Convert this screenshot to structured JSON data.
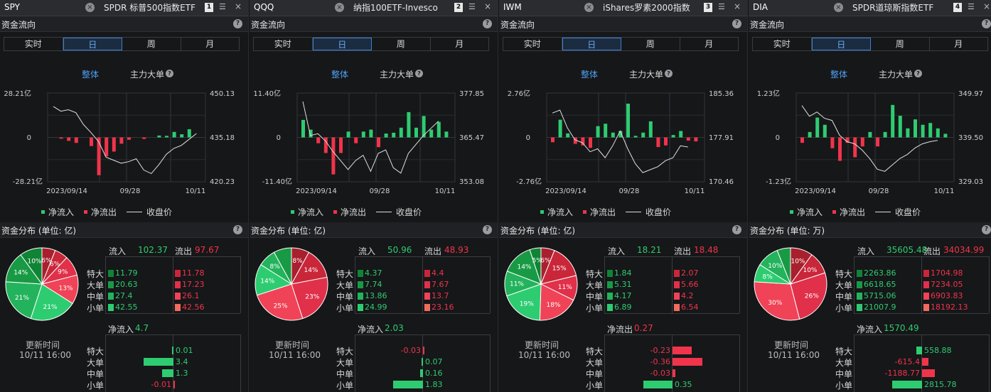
{
  "labels": {
    "flow_section": "资金流向",
    "periods": [
      "实时",
      "日",
      "周",
      "月"
    ],
    "active_period": 1,
    "view_all": "整体",
    "view_main": "主力大单",
    "help": "?",
    "legend_in": "净流入",
    "legend_out": "净流出",
    "legend_close": "收盘价",
    "inflow": "流入",
    "outflow": "流出",
    "rows": [
      "特大",
      "大单",
      "中单",
      "小单"
    ],
    "update_label": "更新时间",
    "update_time": "10/11 16:00",
    "x_ticks": [
      "2023/09/14",
      "09/28",
      "10/11"
    ],
    "close_icon": "×",
    "settings_icon": "settings-sliders-icon"
  },
  "colors": {
    "up": "#2ecc71",
    "down": "#f0344b",
    "bg": "#161719",
    "accent": "#4d9ef0"
  },
  "panels": [
    {
      "code": "SPY",
      "name": "SPDR 标普500指数ETF",
      "num": "1",
      "dist_title": "资金分布 (单位: 亿)",
      "chart_data": {
        "type": "bar",
        "y_left": {
          "top": "28.21亿",
          "mid": "0",
          "bottom": "-28.21亿",
          "max": 28.21
        },
        "y_right": {
          "top": "450.13",
          "mid": "435.18",
          "bottom": "420.23",
          "min": 420.23,
          "max": 450.13
        },
        "flows": [
          0,
          -0.8,
          -2.2,
          -3.5,
          0,
          -5.5,
          -24,
          -12,
          -9,
          -4,
          -1.5,
          0,
          -1,
          0,
          1.2,
          1.0,
          3.5,
          2.0,
          5.2
        ],
        "close": [
          445.6,
          444.0,
          444.5,
          443.5,
          439.5,
          436.8,
          433.8,
          428.5,
          427.5,
          426.5,
          427.0,
          428.0,
          424.2,
          423.0,
          426.0,
          429.5,
          431.5,
          432.5,
          434.5,
          436.5
        ]
      },
      "pie": {
        "type": "pie",
        "values": [
          6,
          6,
          9,
          13,
          21,
          21,
          14,
          10
        ],
        "labels": [
          "6%",
          "6%",
          "9%",
          "13%",
          "21%",
          "21%",
          "14%",
          "10%"
        ]
      },
      "dist": {
        "in_total": "102.37",
        "out_total": "97.67",
        "in": [
          "11.79",
          "20.63",
          "27.4",
          "42.55"
        ],
        "out": [
          "11.78",
          "17.23",
          "26.1",
          "42.56"
        ],
        "net_label": "净流入",
        "net_total": "4.7",
        "net_sign": "up",
        "net": [
          "0.01",
          "3.4",
          "1.3",
          "-0.01"
        ],
        "net_values": [
          0.01,
          3.4,
          1.3,
          -0.01
        ]
      }
    },
    {
      "code": "QQQ",
      "name": "纳指100ETF-Invesco",
      "num": "2",
      "dist_title": "资金分布 (单位: 亿)",
      "chart_data": {
        "type": "bar",
        "y_left": {
          "top": "11.40亿",
          "mid": "0",
          "bottom": "-11.40亿",
          "max": 11.4
        },
        "y_right": {
          "top": "377.85",
          "mid": "365.47",
          "bottom": "353.08",
          "min": 353.08,
          "max": 377.85
        },
        "flows": [
          4.5,
          2.0,
          -1.5,
          -4.0,
          -9.5,
          -4.0,
          1.5,
          -1.5,
          1.5,
          2.0,
          -2.5,
          1.0,
          1.2,
          2.5,
          6.5,
          2.5,
          5.5,
          2.0,
          4.0,
          1.5
        ],
        "close": [
          375.5,
          366.0,
          366.5,
          364.5,
          361.5,
          359.0,
          356.5,
          359.0,
          360.5,
          356.0,
          361.0,
          362.0,
          357.0,
          355.5,
          361.0,
          363.5,
          366.0,
          368.0,
          370.0
        ]
      },
      "pie": {
        "type": "pie",
        "values": [
          8,
          14,
          23,
          25,
          14,
          8,
          8
        ],
        "labels": [
          "8%",
          "14%",
          "23%",
          "25%",
          "14%",
          "8%",
          ""
        ]
      },
      "dist": {
        "in_total": "50.96",
        "out_total": "48.93",
        "in": [
          "4.37",
          "7.74",
          "13.86",
          "24.99"
        ],
        "out": [
          "4.4",
          "7.67",
          "13.7",
          "23.16"
        ],
        "net_label": "净流入",
        "net_total": "2.03",
        "net_sign": "up",
        "net": [
          "-0.03",
          "0.07",
          "0.16",
          "1.83"
        ],
        "net_values": [
          -0.03,
          0.07,
          0.16,
          1.83
        ]
      }
    },
    {
      "code": "IWM",
      "name": "iShares罗素2000指数",
      "num": "3",
      "dist_title": "资金分布 (单位: 亿)",
      "chart_data": {
        "type": "bar",
        "y_left": {
          "top": "2.76亿",
          "mid": "0",
          "bottom": "-2.76亿",
          "max": 2.76
        },
        "y_right": {
          "top": "185.36",
          "mid": "177.91",
          "bottom": "170.46",
          "min": 170.46,
          "max": 185.36
        },
        "flows": [
          -0.3,
          1.1,
          0.25,
          -0.4,
          -0.5,
          -0.65,
          0.7,
          0.85,
          0.3,
          0.4,
          2.1,
          0.1,
          0.3,
          1.0,
          -0.6,
          -0.5,
          0.15,
          0.4,
          -0.2,
          -0.25
        ],
        "close": [
          182.0,
          182.5,
          179.5,
          177.5,
          177.0,
          175.5,
          176.0,
          174.5,
          176.5,
          179.0,
          176.0,
          173.5,
          172.0,
          172.5,
          173.0,
          174.0,
          174.5,
          176.5,
          176.3
        ]
      },
      "pie": {
        "type": "pie",
        "values": [
          6,
          15,
          11,
          18,
          19,
          11,
          14,
          5
        ],
        "labels": [
          "6%",
          "15%",
          "11%",
          "18%",
          "19%",
          "11%",
          "14%",
          "5%"
        ]
      },
      "dist": {
        "in_total": "18.21",
        "out_total": "18.48",
        "in": [
          "1.84",
          "5.31",
          "4.17",
          "6.89"
        ],
        "out": [
          "2.07",
          "5.66",
          "4.2",
          "6.54"
        ],
        "net_label": "净流出",
        "net_total": "0.27",
        "net_sign": "down",
        "net": [
          "-0.23",
          "-0.36",
          "-0.03",
          "0.35"
        ],
        "net_values": [
          -0.23,
          -0.36,
          -0.03,
          0.35
        ]
      }
    },
    {
      "code": "DIA",
      "name": "SPDR道琼斯指数ETF",
      "num": "4",
      "dist_title": "资金分布 (单位: 万)",
      "chart_data": {
        "type": "bar",
        "y_left": {
          "top": "1.23亿",
          "mid": "0",
          "bottom": "-1.23亿",
          "max": 1.23
        },
        "y_right": {
          "top": "349.97",
          "mid": "339.50",
          "bottom": "329.03",
          "min": 329.03,
          "max": 349.97
        },
        "flows": [
          -0.15,
          0.15,
          0.55,
          0.35,
          -0.3,
          -0.65,
          -0.15,
          -0.55,
          -0.25,
          0.15,
          -0.25,
          0.15,
          0.9,
          0.6,
          0.25,
          0.5,
          0.35,
          0.4,
          0.25,
          0.1
        ],
        "close": [
          347.0,
          344.5,
          345.5,
          344.0,
          343.5,
          340.0,
          338.5,
          338.0,
          336.5,
          334.5,
          332.0,
          331.5,
          333.0,
          334.5,
          335.5,
          337.0,
          338.0,
          338.5,
          338.8
        ]
      },
      "pie": {
        "type": "pie",
        "values": [
          10,
          10,
          26,
          30,
          8,
          10,
          6
        ],
        "labels": [
          "10%",
          "10%",
          "26%",
          "30%",
          "8%",
          "10%",
          ""
        ]
      },
      "dist": {
        "in_total": "35605.48",
        "out_total": "34034.99",
        "in": [
          "2263.86",
          "6618.65",
          "5715.06",
          "21007.9"
        ],
        "out": [
          "1704.98",
          "7234.05",
          "6903.83",
          "18192.13"
        ],
        "net_label": "净流入",
        "net_total": "1570.49",
        "net_sign": "up",
        "net": [
          "558.88",
          "-615.4",
          "-1188.77",
          "2815.78"
        ],
        "net_values": [
          558.88,
          -615.4,
          -1188.77,
          2815.78
        ]
      }
    }
  ]
}
